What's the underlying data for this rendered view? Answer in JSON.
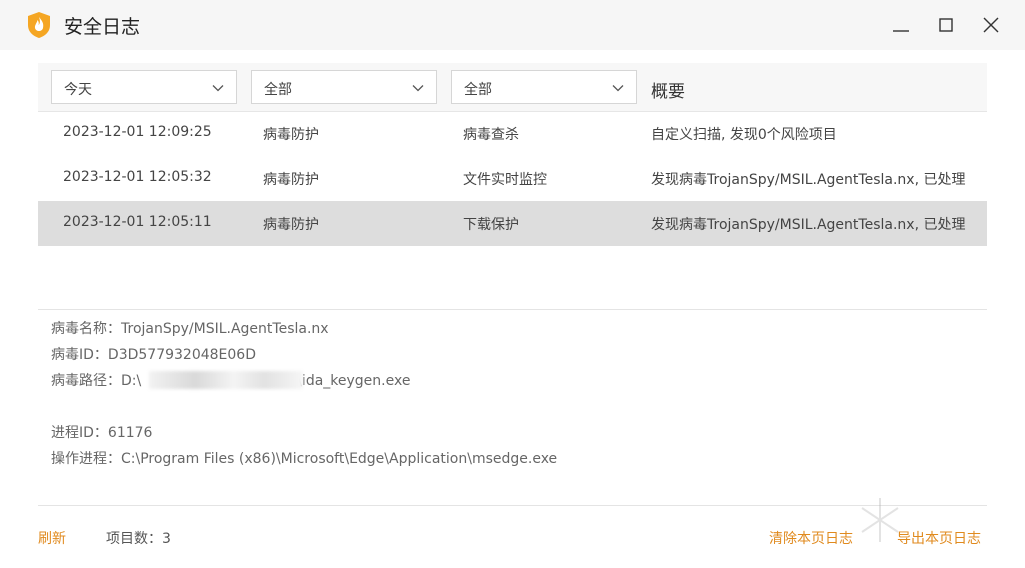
{
  "window": {
    "title": "安全日志",
    "minimize_icon": "minimize-icon",
    "maximize_icon": "maximize-icon",
    "close_icon": "close-icon"
  },
  "colors": {
    "accent": "#e08a1e",
    "logo": "#f5a623",
    "selected_row": "#dddddd"
  },
  "filters": {
    "date": "今天",
    "category": "全部",
    "source": "全部",
    "summary_header": "概要"
  },
  "logs": [
    {
      "time": "2023-12-01 12:09:25",
      "category": "病毒防护",
      "source": "病毒查杀",
      "summary": "自定义扫描, 发现0个风险项目"
    },
    {
      "time": "2023-12-01 12:05:32",
      "category": "病毒防护",
      "source": "文件实时监控",
      "summary": "发现病毒TrojanSpy/MSIL.AgentTesla.nx, 已处理"
    },
    {
      "time": "2023-12-01 12:05:11",
      "category": "病毒防护",
      "source": "下载保护",
      "summary": "发现病毒TrojanSpy/MSIL.AgentTesla.nx, 已处理"
    }
  ],
  "detail": {
    "virus_name": "病毒名称：TrojanSpy/MSIL.AgentTesla.nx",
    "virus_id": "病毒ID：D3D577932048E06D",
    "virus_path_prefix": "病毒路径：D:\\",
    "virus_path_suffix": "\\ida_keygen.exe",
    "process_id": "进程ID：61176",
    "process": "操作进程：C:\\Program Files (x86)\\Microsoft\\Edge\\Application\\msedge.exe"
  },
  "footer": {
    "refresh": "刷新",
    "item_count": "项目数：3",
    "clear": "清除本页日志",
    "export": "导出本页日志"
  }
}
